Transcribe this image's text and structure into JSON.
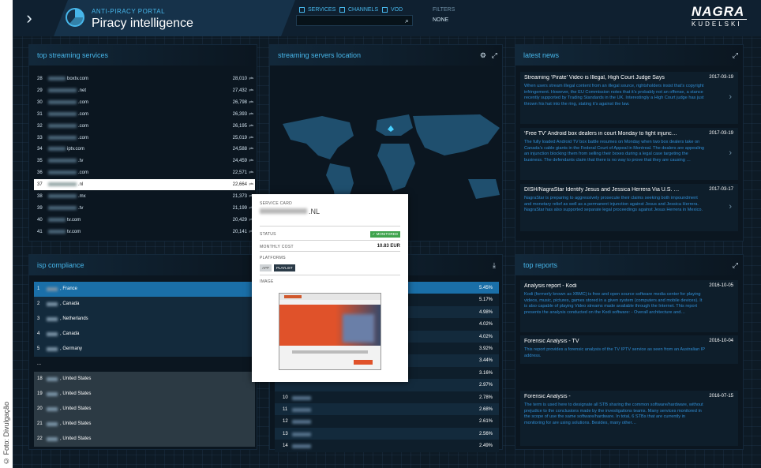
{
  "credit": "© Foto: Divulgação",
  "header": {
    "portal_label": "ANTI-PIRACY PORTAL",
    "portal_title": "Piracy intelligence",
    "filter_services": "SERVICES",
    "filter_channels": "CHANNELS",
    "filter_vod": "VOD",
    "search_value": "",
    "filters_label": "FILTERS",
    "filters_value": "NONE",
    "brand_name": "NAGRA",
    "brand_sub": "KUDELSKI"
  },
  "streaming": {
    "title": "top streaming services",
    "rows": [
      {
        "rank": "28",
        "name": "boxtv.com",
        "value": "28,010",
        "unit": "pts"
      },
      {
        "rank": "29",
        "name": ".net",
        "value": "27,432",
        "unit": "pts"
      },
      {
        "rank": "30",
        "name": ".com",
        "value": "26,798",
        "unit": "pts"
      },
      {
        "rank": "31",
        "name": ".com",
        "value": "26,393",
        "unit": "pts"
      },
      {
        "rank": "32",
        "name": ".com",
        "value": "26,195",
        "unit": "pts"
      },
      {
        "rank": "33",
        "name": ".com",
        "value": "25,019",
        "unit": "pts"
      },
      {
        "rank": "34",
        "name": "iptv.com",
        "value": "24,588",
        "unit": "pts"
      },
      {
        "rank": "35",
        "name": ".tv",
        "value": "24,459",
        "unit": "pts"
      },
      {
        "rank": "36",
        "name": ".com",
        "value": "22,571",
        "unit": "pts"
      },
      {
        "rank": "37",
        "name": ".nl",
        "value": "22,664",
        "unit": "pts"
      },
      {
        "rank": "38",
        "name": ".mx",
        "value": "21,373",
        "unit": "pts"
      },
      {
        "rank": "39",
        "name": ".tv",
        "value": "21,199",
        "unit": "pts"
      },
      {
        "rank": "40",
        "name": "tv.com",
        "value": "20,429",
        "unit": "pts"
      },
      {
        "rank": "41",
        "name": "tv.com",
        "value": "20,141",
        "unit": "pts"
      }
    ]
  },
  "map": {
    "title": "streaming servers location"
  },
  "news": {
    "title": "latest news",
    "items": [
      {
        "title": "Streaming ‘Pirate’ Video is Illegal, High Court Judge Says",
        "date": "2017-03-19",
        "body": "When users stream illegal content from an illegal source, rightsholders insist that’s copyright infringement. However, the EU Commission notes that it’s probably not an offense, a stance recently supported by Trading Standards in the UK. Interestingly a High Court judge has just thrown his hat into the ring, stating it’s against the law."
      },
      {
        "title": "‘Free TV’ Android box dealers in court Monday to fight injunc…",
        "date": "2017-03-19",
        "body": "The fully loaded Android TV box battle resumes on Monday when two box dealers take on Canada’s cable giants in the Federal Court of Appeal in Montreal. The dealers are appealing an injunction blocking them from selling their boxes during a legal case targeting the business. The defendants claim that there is no way to prove that they are causing …"
      },
      {
        "title": "DISH/NagraStar Identify Jesus and Jessica Herrera Via U.S. …",
        "date": "2017-03-17",
        "body": "NagraStar is preparing to aggressively prosecute their claims seeking both impoundment and monetary relief as well as a permanent injunction against Jesus and Jessica Herrera. NagraStar has also supported separate legal proceedings against Jesus Herrera in Mexico."
      }
    ]
  },
  "isp": {
    "title": "isp compliance",
    "rows": [
      {
        "rank": "1",
        "name": ", France"
      },
      {
        "rank": "2",
        "name": ", Canada"
      },
      {
        "rank": "3",
        "name": ", Netherlands"
      },
      {
        "rank": "4",
        "name": ", Canada"
      },
      {
        "rank": "5",
        "name": ", Germany"
      },
      {
        "rank": "...",
        "name": ""
      },
      {
        "rank": "18",
        "name": ", United States"
      },
      {
        "rank": "19",
        "name": ", United States"
      },
      {
        "rank": "20",
        "name": ", United States"
      },
      {
        "rank": "21",
        "name": ", United States"
      },
      {
        "rank": "22",
        "name": ", United States"
      }
    ]
  },
  "compliance": {
    "rows": [
      {
        "rank": "",
        "value": "5.45%"
      },
      {
        "rank": "",
        "value": "5.17%"
      },
      {
        "rank": "",
        "value": "4.98%"
      },
      {
        "rank": "",
        "value": "4.02%"
      },
      {
        "rank": "",
        "value": "4.02%"
      },
      {
        "rank": "",
        "value": "3.92%"
      },
      {
        "rank": "",
        "value": "3.44%"
      },
      {
        "rank": "",
        "value": "3.16%"
      },
      {
        "rank": "",
        "value": "2.97%"
      },
      {
        "rank": "10",
        "value": "2.78%"
      },
      {
        "rank": "11",
        "value": "2.68%"
      },
      {
        "rank": "12",
        "value": "2.61%"
      },
      {
        "rank": "13",
        "value": "2.56%"
      },
      {
        "rank": "14",
        "value": "2.49%"
      }
    ]
  },
  "reports": {
    "title": "top reports",
    "items": [
      {
        "title": "Analysis report - Kodi",
        "date": "2016-10-05",
        "body": "Kodi (formerly known as XBMC) is free and open source software media center for playing videos, music, pictures, games stored in a given system (computers and mobile devices). It is also capable of playing Video streams made available through the Internet. This report presents the analysis conducted on the Kodi software: - Overall architecture and…"
      },
      {
        "title": "Forensic Analysis - TV",
        "date": "2016-10-04",
        "body": "This report provides a forensic analysis of the TV IPTV service as seen from an Australian IP address."
      },
      {
        "title": "Forensic Analysis -",
        "date": "2016-07-15",
        "body": "The term is used here to designate all STB sharing the common software/hardware, without prejudice to the conclusions made by the investigations teams. Many services monitored in the scope of use the same software/hardware. In total, 6 STBs that are currently in monitoring for are using solutions. Besides, many other…"
      }
    ]
  },
  "service_card": {
    "label": "SERVICE CARD",
    "name": ".NL",
    "status_label": "STATUS",
    "status_value": "✓ MONITORED",
    "cost_label": "MONTHLY COST",
    "cost_value": "10.83 EUR",
    "platforms_label": "PLATFORMS",
    "platforms": [
      "APP",
      "PLAYLIST"
    ],
    "image_label": "IMAGE"
  },
  "colors": {
    "accent": "#47b6ea",
    "panel": "#0b1620",
    "highlight_row": "#1a6fa8",
    "monitored": "#3fa34d"
  }
}
